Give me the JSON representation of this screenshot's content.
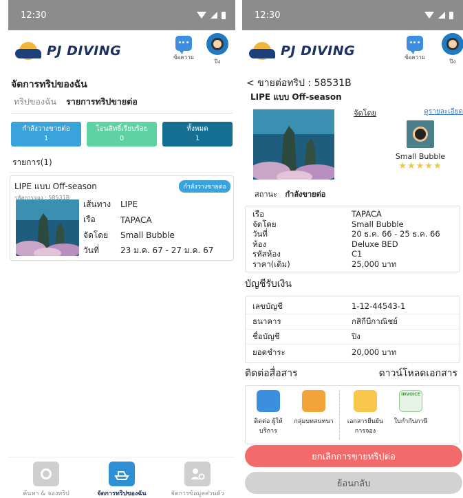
{
  "left": {
    "status_time": "12:30",
    "brand": "PJ DIVING",
    "header": {
      "messages_label": "ข้อความ",
      "profile_label": "ปิง"
    },
    "page_title": "จัดการทริปของฉัน",
    "tabs": [
      "ทริปของฉัน",
      "รายการทริปขายต่อ"
    ],
    "status_cards": [
      {
        "label": "กำลังวางขายต่อ",
        "count": "1",
        "color": "#3aa3dc"
      },
      {
        "label": "โอนสิทธิ์เรียบร้อย",
        "count": "0",
        "color": "#5fd2a4"
      },
      {
        "label": "ทั้งหมด",
        "count": "1",
        "color": "#156f93"
      }
    ],
    "list_heading": "รายการ(1)",
    "trip": {
      "name": "LIPE แบบ Off-season",
      "code": "รหัสการจอง : 58531B",
      "tag": "กำลังวางขายต่อ",
      "rows": [
        {
          "k": "เส้นทาง",
          "v": "LIPE"
        },
        {
          "k": "เรือ",
          "v": "TAPACA"
        },
        {
          "k": "จัดโดย",
          "v": "Small Bubble"
        },
        {
          "k": "วันที่",
          "v": "23 ม.ค. 67 - 27 ม.ค. 67"
        }
      ]
    },
    "bottom_nav": [
      "ค้นหา & จองทริป",
      "จัดการทริปของฉัน",
      "จัดการข้อมูลส่วนตัว"
    ]
  },
  "right": {
    "status_time": "12:30",
    "brand": "PJ DIVING",
    "header": {
      "messages_label": "ข้อความ",
      "profile_label": "ปิง"
    },
    "back_title": "< ขายต่อทริป : 58531B",
    "trip_title": "LIPE แบบ Off-season",
    "organizer_label": "จัดโดย",
    "detail_link": "ดูรายละเอียด",
    "operator_name": "Small Bubble",
    "rating_stars": "★★★★★",
    "status_label": "สถานะ",
    "status_value": "กำลังขายต่อ",
    "trip_rows": [
      {
        "k": "เรือ",
        "v": "TAPACA"
      },
      {
        "k": "จัดโดย",
        "v": "Small Bubble"
      },
      {
        "k": "วันที่",
        "v": "20 ธ.ค. 66 - 25 ธ.ค. 66"
      },
      {
        "k": "ห้อง",
        "v": "Deluxe BED"
      },
      {
        "k": "รหัสห้อง",
        "v": "C1"
      },
      {
        "k": "ราคา(เดิม)",
        "v": "25,000 บาท"
      }
    ],
    "account_title": "บัญชีรับเงิน",
    "account_rows": [
      {
        "k": "เลขบัญชี",
        "v": "1-12-44543-1"
      },
      {
        "k": "ธนาคาร",
        "v": "กสิกีบีกาณิชย์"
      },
      {
        "k": "ชื่อบัญชี",
        "v": "ปิง"
      },
      {
        "k": "ยอดชำระ",
        "v": "20,000 บาท"
      }
    ],
    "contact_title": "ติดต่อสื่อสาร",
    "download_title": "ดาวน์โหลดเอกสาร",
    "contact_buttons": [
      "ติดต่อ ผู้ให้บริการ",
      "กลุ่มบทสนทนา"
    ],
    "download_buttons": [
      "เอกสารยืนยัน การจอง",
      "ใบกำกับภาษี"
    ],
    "invoice_text": "INVOICE",
    "cancel_button": "ยกเลิกการขายทริปต่อ",
    "back_button": "ย้อนกลับ"
  }
}
